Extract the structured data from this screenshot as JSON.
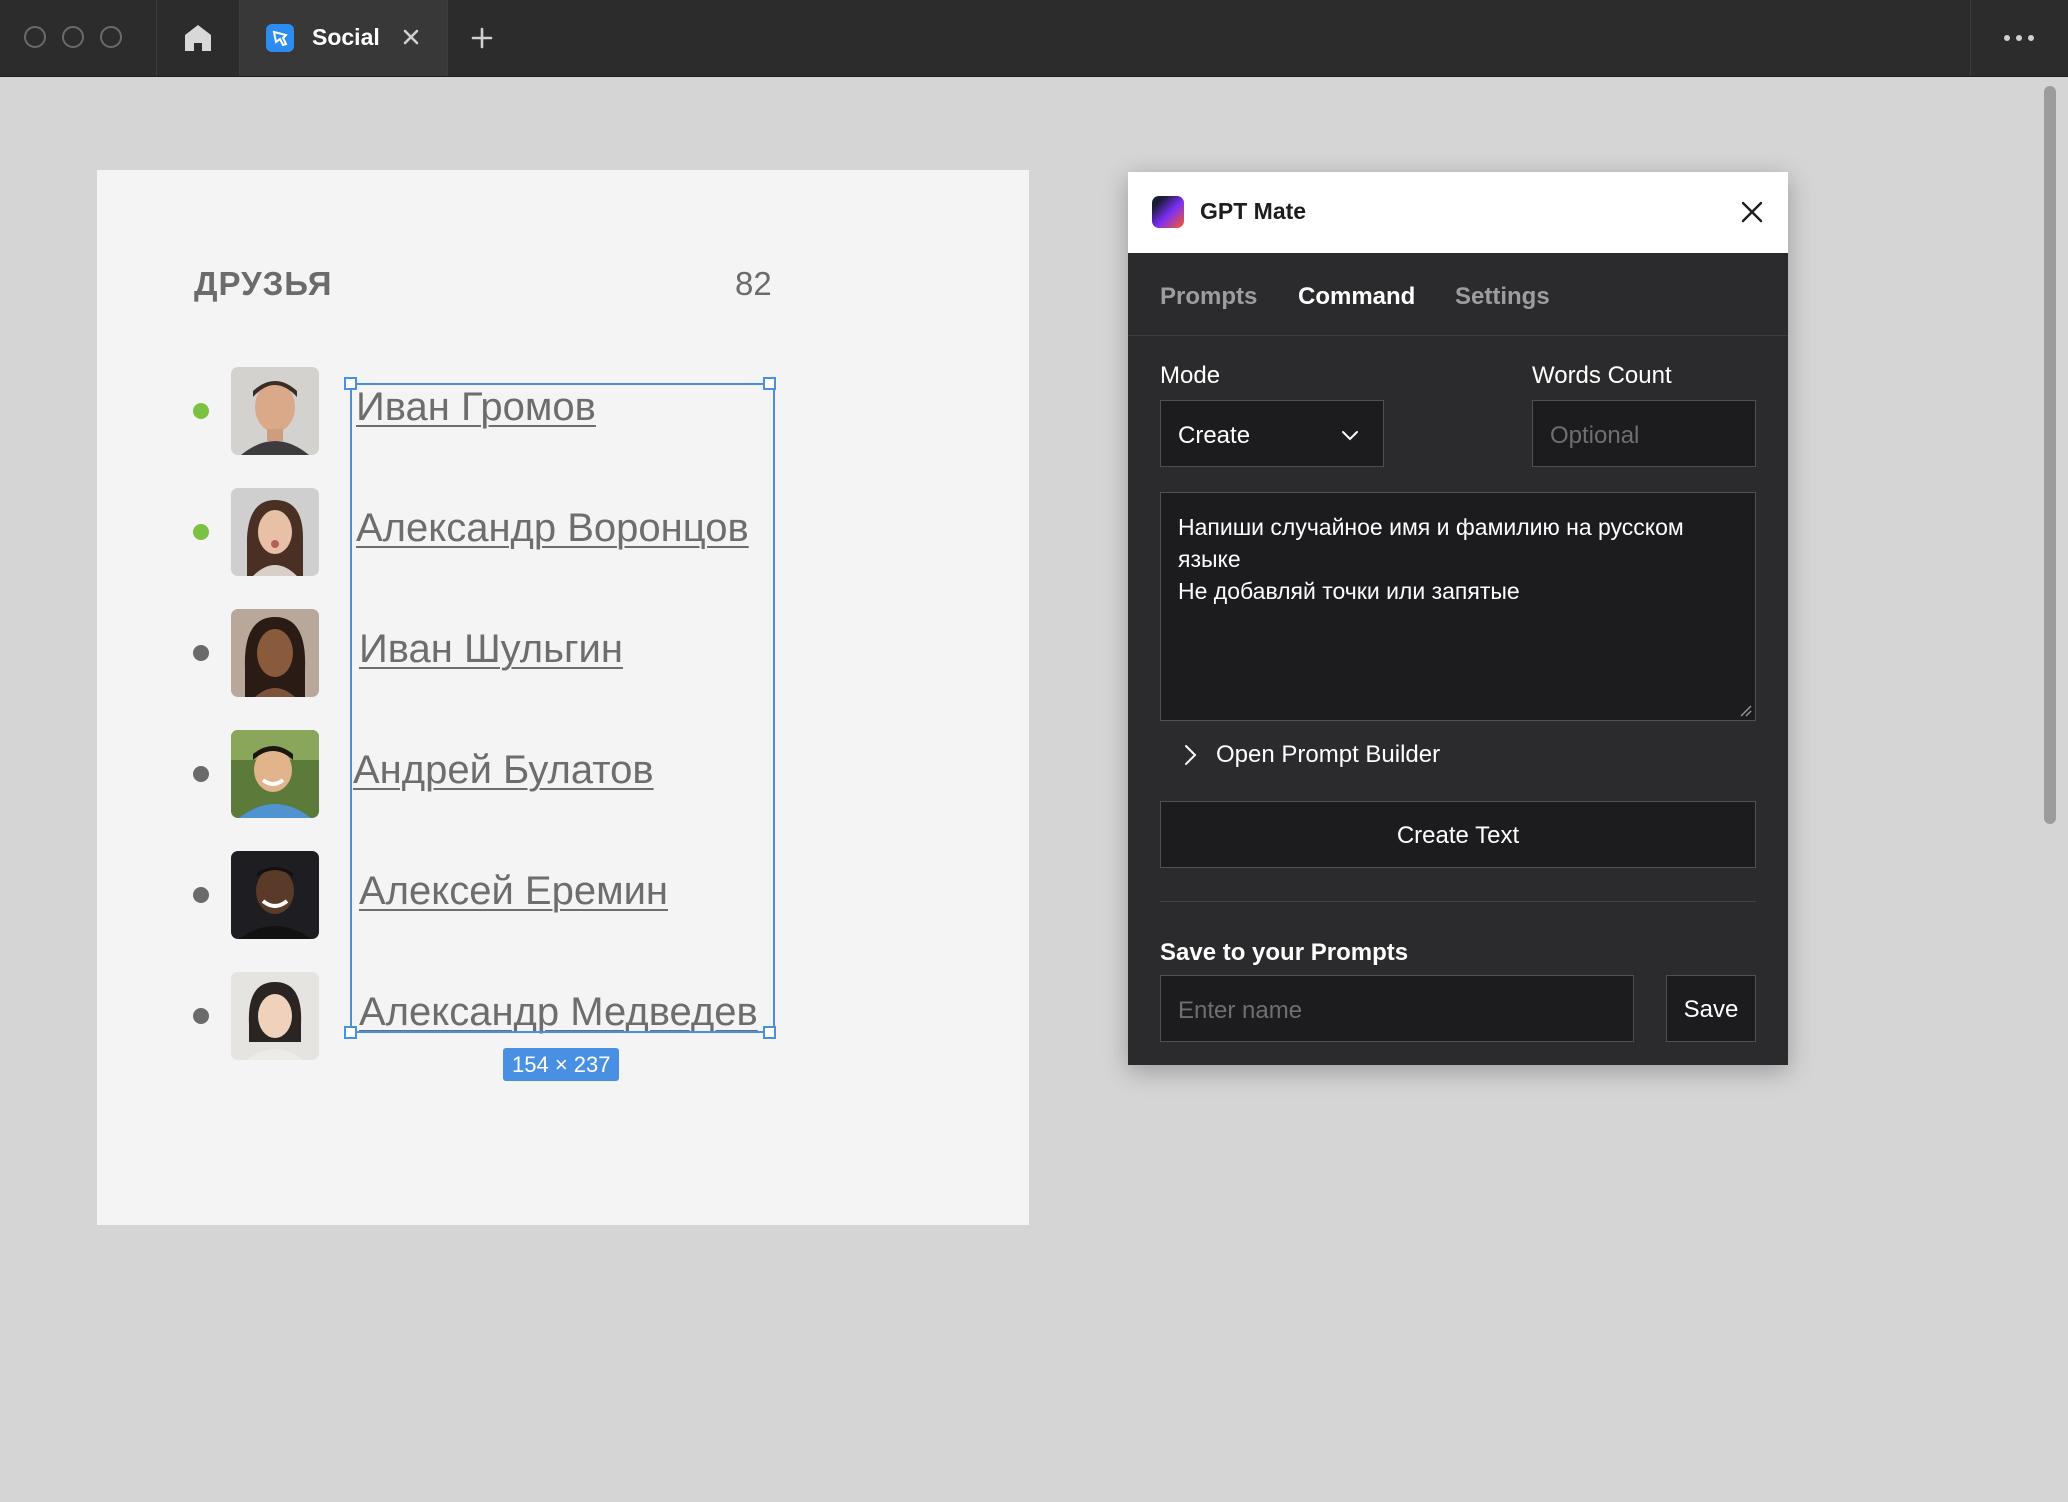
{
  "browser": {
    "tab_label": "Social"
  },
  "design": {
    "section_title": "ДРУЗЬЯ",
    "count": "82",
    "friends": [
      {
        "name": "Иван Громов",
        "online": true
      },
      {
        "name": "Александр Воронцов",
        "online": true
      },
      {
        "name": "Иван Шульгин",
        "online": false
      },
      {
        "name": "Андрей Булатов",
        "online": false
      },
      {
        "name": "Алексей Еремин",
        "online": false
      },
      {
        "name": "Александр Медведев",
        "online": false
      }
    ],
    "selection_size": "154 × 237"
  },
  "plugin": {
    "title": "GPT Mate",
    "tabs": [
      "Prompts",
      "Command",
      "Settings"
    ],
    "active_tab": "Command",
    "mode_label": "Mode",
    "mode_value": "Create",
    "words_count_label": "Words Count",
    "words_count_placeholder": "Optional",
    "prompt_text": "Напиши случайное имя и фамилию на русском языке\nНе добавляй точки или запятые",
    "open_builder_label": "Open Prompt Builder",
    "create_button": "Create Text",
    "save_section_title": "Save to your Prompts",
    "name_placeholder": "Enter name",
    "save_button": "Save"
  },
  "colors": {
    "online": "#7cc242",
    "offline": "#6a6a6a",
    "selection": "#4a90e2",
    "plugin_bg": "#2b2b2d"
  }
}
